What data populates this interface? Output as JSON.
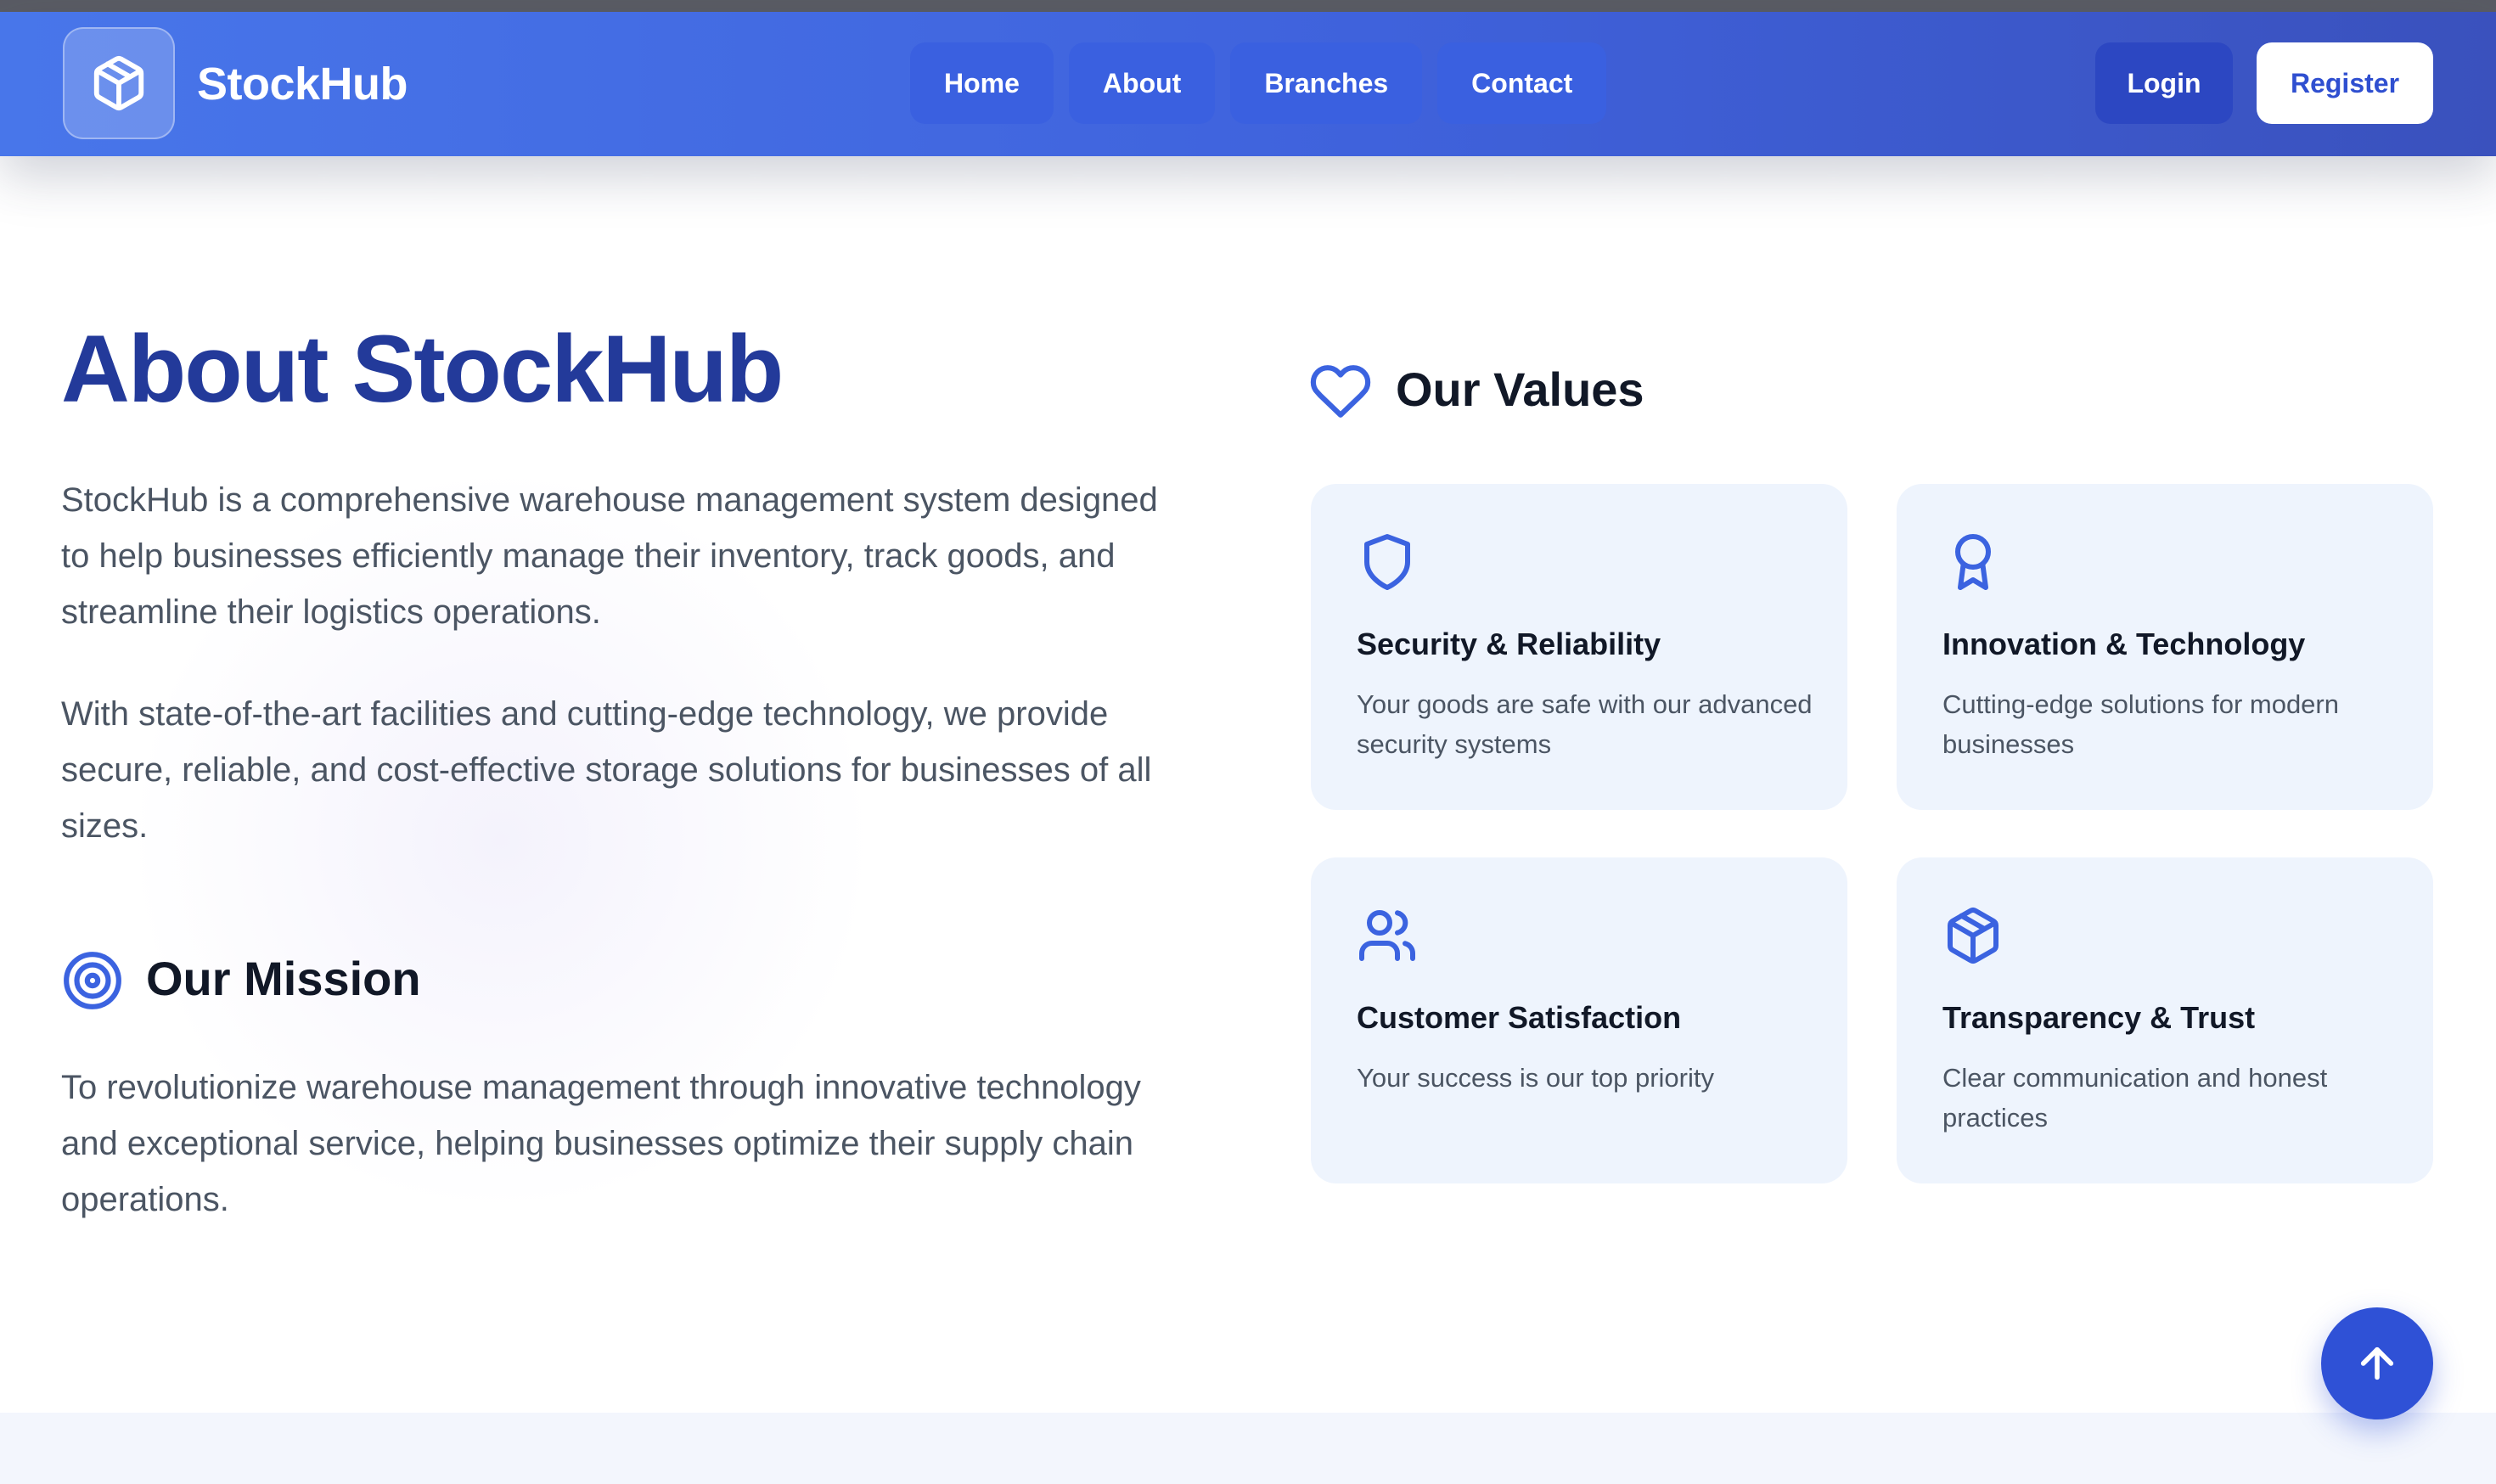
{
  "colors": {
    "accent": "#3b63e0",
    "title": "#233a9a",
    "card_bg": "#eef4fd",
    "text": "#4b5563",
    "heading": "#111827"
  },
  "navbar": {
    "logo_icon": "cube-icon",
    "brand": "StockHub",
    "links": [
      "Home",
      "About",
      "Branches",
      "Contact"
    ],
    "login": "Login",
    "register": "Register"
  },
  "about": {
    "title": "About StockHub",
    "paragraph1": "StockHub is a comprehensive warehouse management system designed to help businesses efficiently manage their inventory, track goods, and streamline their logistics operations.",
    "paragraph2": "With state-of-the-art facilities and cutting-edge technology, we provide secure, reliable, and cost-effective storage solutions for businesses of all sizes.",
    "mission_icon": "target-icon",
    "mission_title": "Our Mission",
    "mission_text": "To revolutionize warehouse management through innovative technology and exceptional service, helping businesses optimize their supply chain operations."
  },
  "values": {
    "icon": "heart-icon",
    "title": "Our Values",
    "cards": [
      {
        "icon": "shield-icon",
        "title": "Security & Reliability",
        "text": "Your goods are safe with our advanced security systems"
      },
      {
        "icon": "award-icon",
        "title": "Innovation & Technology",
        "text": "Cutting-edge solutions for modern businesses"
      },
      {
        "icon": "users-icon",
        "title": "Customer Satisfaction",
        "text": "Your success is our top priority"
      },
      {
        "icon": "package-icon",
        "title": "Transparency & Trust",
        "text": "Clear communication and honest practices"
      }
    ]
  },
  "scroll_top_icon": "arrow-up-icon"
}
